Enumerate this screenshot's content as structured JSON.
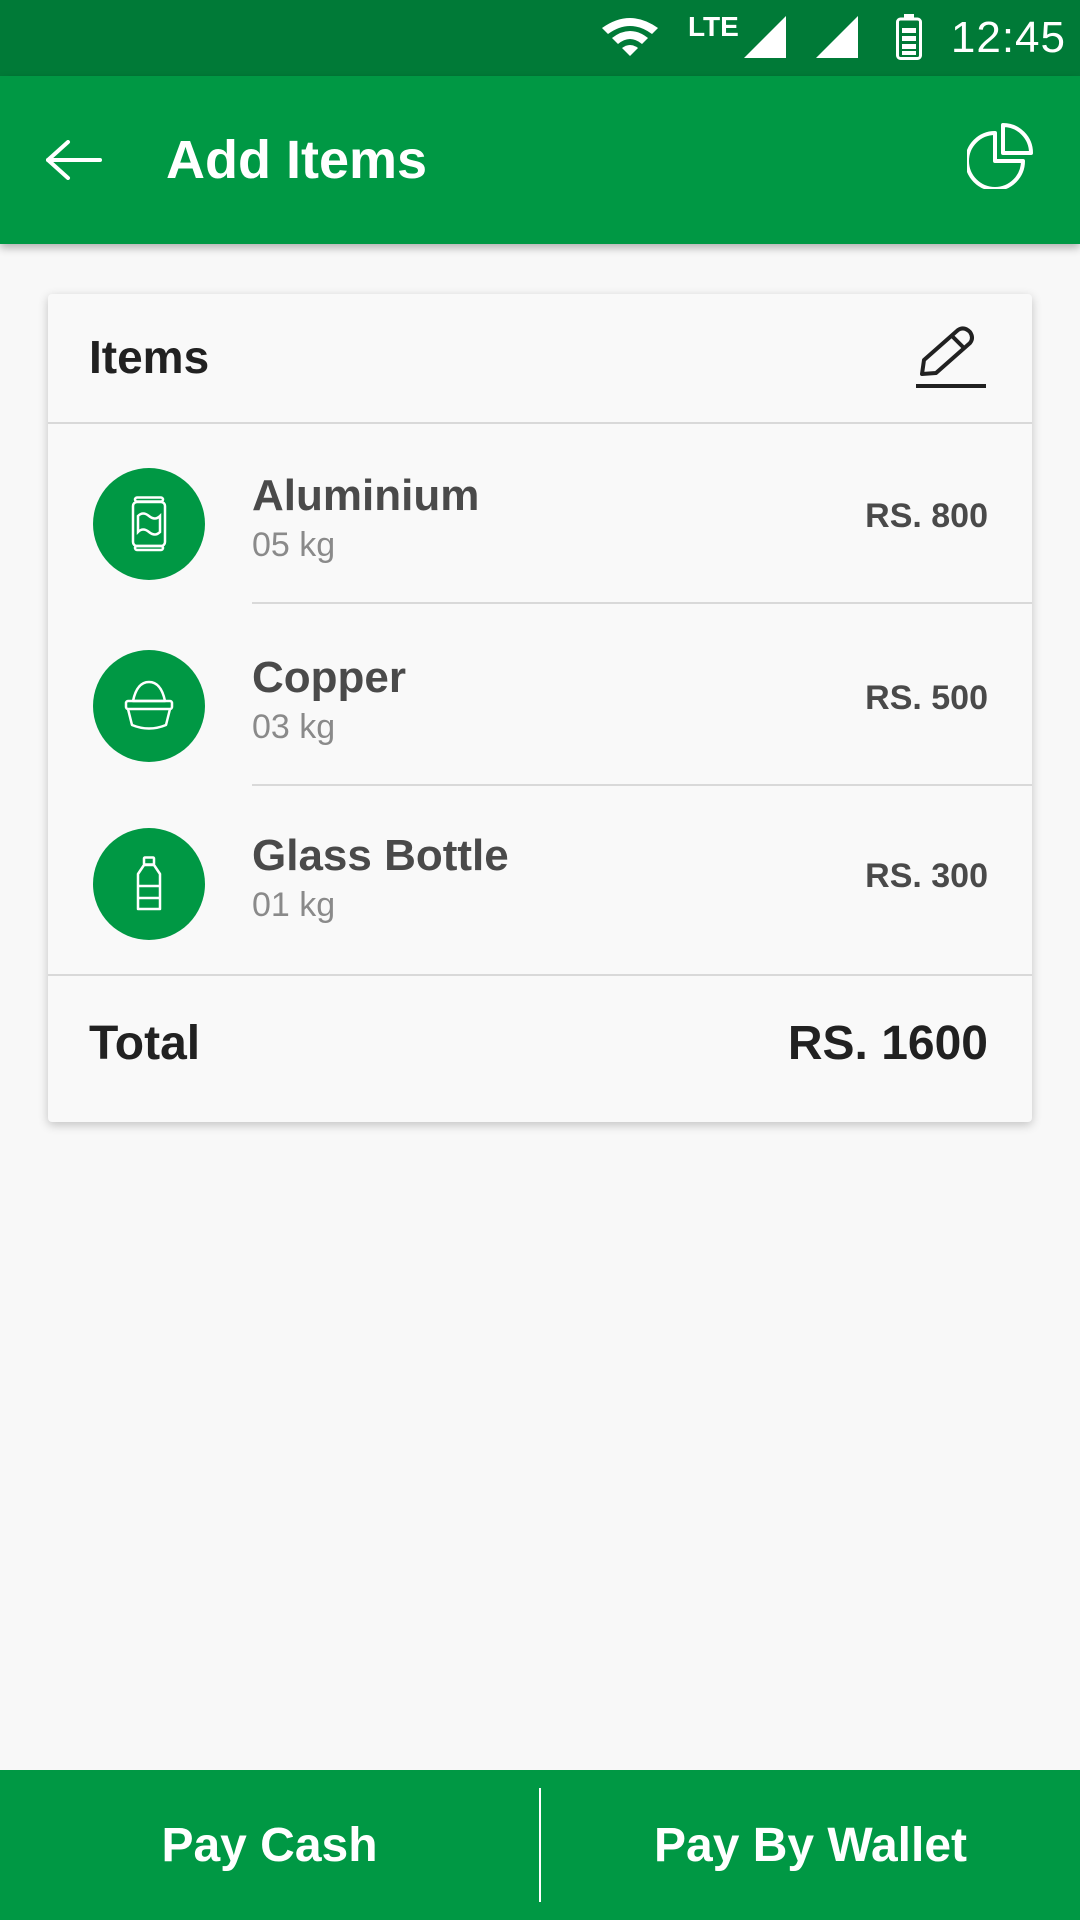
{
  "status_bar": {
    "network_label": "LTE",
    "time": "12:45",
    "icons": [
      "wifi-icon",
      "cell-signal-icon",
      "cell-signal-icon",
      "battery-icon"
    ]
  },
  "app_bar": {
    "title": "Add Items",
    "back_icon": "arrow-left-icon",
    "action_icon": "pie-chart-icon"
  },
  "card": {
    "header_label": "Items",
    "edit_icon": "pencil-icon",
    "items": [
      {
        "name": "Aluminium",
        "weight": "05 kg",
        "price": "RS. 800",
        "icon": "can-icon"
      },
      {
        "name": "Copper",
        "weight": "03 kg",
        "price": "RS. 500",
        "icon": "copper-pot-icon"
      },
      {
        "name": "Glass Bottle",
        "weight": "01 kg",
        "price": "RS. 300",
        "icon": "bottle-icon"
      }
    ],
    "total_label": "Total",
    "total_value": "RS. 1600"
  },
  "bottom_bar": {
    "pay_cash_label": "Pay Cash",
    "pay_wallet_label": "Pay By Wallet"
  },
  "colors": {
    "status_bar": "#007a37",
    "primary": "#009844",
    "background": "#f8f8f8",
    "card": "#f9f9f9"
  }
}
